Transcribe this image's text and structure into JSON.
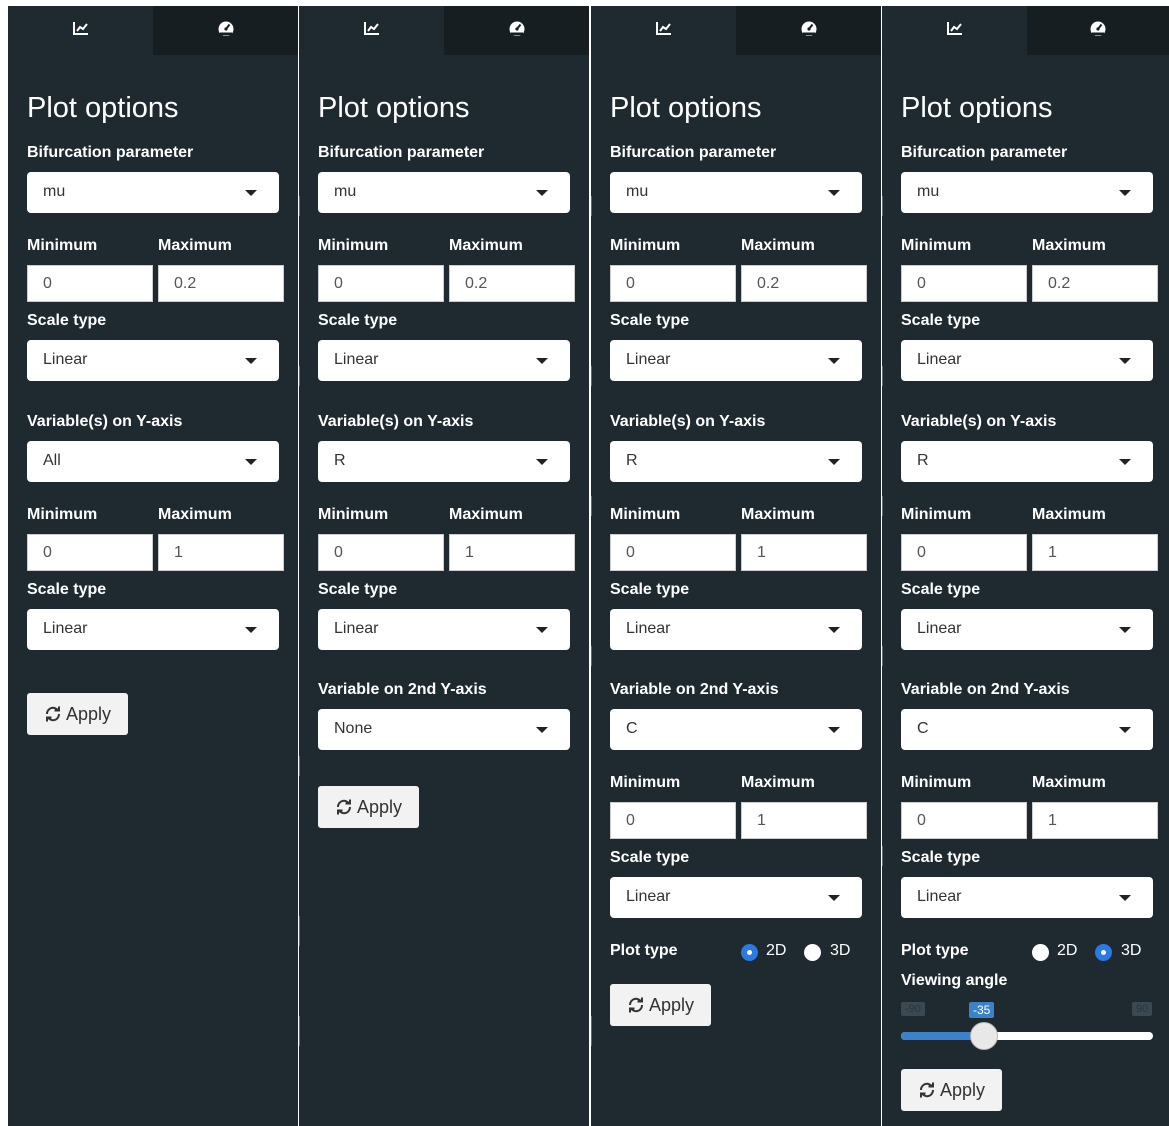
{
  "panels": [
    {
      "title": "Plot options",
      "bifurcation": {
        "label": "Bifurcation parameter",
        "value": "mu"
      },
      "x_range": {
        "min_label": "Minimum",
        "max_label": "Maximum",
        "min": "0",
        "max": "0.2"
      },
      "x_scale": {
        "label": "Scale type",
        "value": "Linear"
      },
      "yvars": {
        "label": "Variable(s) on Y-axis",
        "value": "All"
      },
      "y_range": {
        "min_label": "Minimum",
        "max_label": "Maximum",
        "min": "0",
        "max": "1"
      },
      "y_scale": {
        "label": "Scale type",
        "value": "Linear"
      },
      "apply_label": "Apply"
    },
    {
      "title": "Plot options",
      "bifurcation": {
        "label": "Bifurcation parameter",
        "value": "mu"
      },
      "x_range": {
        "min_label": "Minimum",
        "max_label": "Maximum",
        "min": "0",
        "max": "0.2"
      },
      "x_scale": {
        "label": "Scale type",
        "value": "Linear"
      },
      "yvars": {
        "label": "Variable(s) on Y-axis",
        "value": "R"
      },
      "y_range": {
        "min_label": "Minimum",
        "max_label": "Maximum",
        "min": "0",
        "max": "1"
      },
      "y_scale": {
        "label": "Scale type",
        "value": "Linear"
      },
      "y2var": {
        "label": "Variable on 2nd Y-axis",
        "value": "None"
      },
      "apply_label": "Apply"
    },
    {
      "title": "Plot options",
      "bifurcation": {
        "label": "Bifurcation parameter",
        "value": "mu"
      },
      "x_range": {
        "min_label": "Minimum",
        "max_label": "Maximum",
        "min": "0",
        "max": "0.2"
      },
      "x_scale": {
        "label": "Scale type",
        "value": "Linear"
      },
      "yvars": {
        "label": "Variable(s) on Y-axis",
        "value": "R"
      },
      "y_range": {
        "min_label": "Minimum",
        "max_label": "Maximum",
        "min": "0",
        "max": "1"
      },
      "y_scale": {
        "label": "Scale type",
        "value": "Linear"
      },
      "y2var": {
        "label": "Variable on 2nd Y-axis",
        "value": "C"
      },
      "y2_range": {
        "min_label": "Minimum",
        "max_label": "Maximum",
        "min": "0",
        "max": "1"
      },
      "y2_scale": {
        "label": "Scale type",
        "value": "Linear"
      },
      "plot_type": {
        "label": "Plot type",
        "opt_2d": "2D",
        "opt_3d": "3D",
        "selected": "2D"
      },
      "apply_label": "Apply"
    },
    {
      "title": "Plot options",
      "bifurcation": {
        "label": "Bifurcation parameter",
        "value": "mu"
      },
      "x_range": {
        "min_label": "Minimum",
        "max_label": "Maximum",
        "min": "0",
        "max": "0.2"
      },
      "x_scale": {
        "label": "Scale type",
        "value": "Linear"
      },
      "yvars": {
        "label": "Variable(s) on Y-axis",
        "value": "R"
      },
      "y_range": {
        "min_label": "Minimum",
        "max_label": "Maximum",
        "min": "0",
        "max": "1"
      },
      "y_scale": {
        "label": "Scale type",
        "value": "Linear"
      },
      "y2var": {
        "label": "Variable on 2nd Y-axis",
        "value": "C"
      },
      "y2_range": {
        "min_label": "Minimum",
        "max_label": "Maximum",
        "min": "0",
        "max": "1"
      },
      "y2_scale": {
        "label": "Scale type",
        "value": "Linear"
      },
      "plot_type": {
        "label": "Plot type",
        "opt_2d": "2D",
        "opt_3d": "3D",
        "selected": "3D"
      },
      "viewing_angle": {
        "label": "Viewing angle",
        "min": "-90",
        "max": "90",
        "value": "-35"
      },
      "apply_label": "Apply"
    }
  ],
  "tabs": {
    "icons": [
      "line-chart-icon",
      "dashboard-gauge-icon"
    ]
  },
  "colors": {
    "panel_bg": "#1f2a30",
    "inactive_tab": "#161e22",
    "accent": "#2a7ae2",
    "slider_fill": "#3b82c8"
  }
}
